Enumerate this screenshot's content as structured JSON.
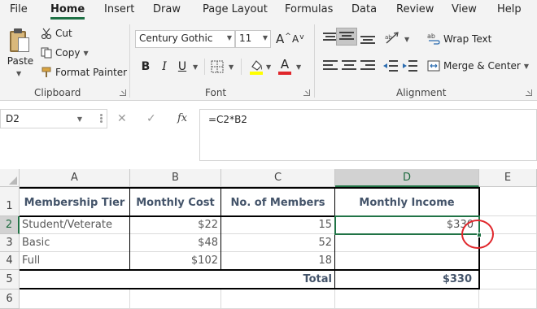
{
  "menu": {
    "tabs": [
      "File",
      "Home",
      "Insert",
      "Draw",
      "Page Layout",
      "Formulas",
      "Data",
      "Review",
      "View",
      "Help"
    ],
    "active": "Home"
  },
  "ribbon": {
    "clipboard": {
      "paste": "Paste",
      "cut": "Cut",
      "copy": "Copy",
      "format_painter": "Format Painter",
      "group_label": "Clipboard"
    },
    "font": {
      "font_name": "Century Gothic",
      "font_size": "11",
      "grow_glyph": "A",
      "shrink_glyph": "A",
      "bold": "B",
      "italic": "I",
      "underline": "U",
      "font_color_glyph": "A",
      "group_label": "Font",
      "fill_color": "#ffff00",
      "font_color": "#e0262b"
    },
    "alignment": {
      "wrap_text": "Wrap Text",
      "merge_center": "Merge & Center",
      "group_label": "Alignment",
      "wrap_glyph": "ab"
    }
  },
  "formula_bar": {
    "name_box": "D2",
    "fx_label": "fx",
    "cancel_glyph": "✕",
    "enter_glyph": "✓",
    "formula": "=C2*B2"
  },
  "grid": {
    "columns": [
      "A",
      "B",
      "C",
      "D",
      "E"
    ],
    "rows": [
      "1",
      "2",
      "3",
      "4",
      "5",
      "6"
    ],
    "selected_column": "D",
    "selected_row": "2",
    "cells": {
      "A1": "Membership Tier",
      "B1": "Monthly Cost",
      "C1": "No. of Members",
      "D1": "Monthly Income",
      "A2": "Student/Veterate",
      "B2": "$22",
      "C2": "15",
      "D2": "$330",
      "A3": "Basic",
      "B3": "$48",
      "C3": "52",
      "D3": "",
      "A4": "Full",
      "B4": "$102",
      "C4": "18",
      "D4": "",
      "C5": "Total",
      "D5": "$330"
    }
  },
  "colors": {
    "accent": "#217346",
    "annotation": "#e0262b",
    "header_text": "#44546a"
  }
}
